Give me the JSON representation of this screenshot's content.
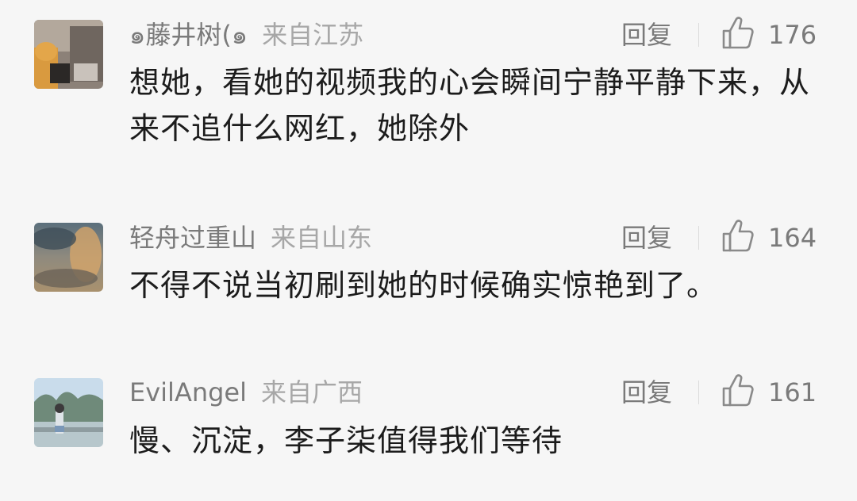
{
  "comments": [
    {
      "username": "๑藤井树(๑",
      "location": "来自江苏",
      "reply_label": "回复",
      "like_count": "176",
      "text": "想她，看她的视频我的心会瞬间宁静平静下来，从来不追什么网红，她除外"
    },
    {
      "username": "轻舟过重山",
      "location": "来自山东",
      "reply_label": "回复",
      "like_count": "164",
      "text": "不得不说当初刷到她的时候确实惊艳到了。"
    },
    {
      "username": "EvilAngel",
      "location": "来自广西",
      "reply_label": "回复",
      "like_count": "161",
      "text": "慢、沉淀，李子柒值得我们等待"
    }
  ]
}
